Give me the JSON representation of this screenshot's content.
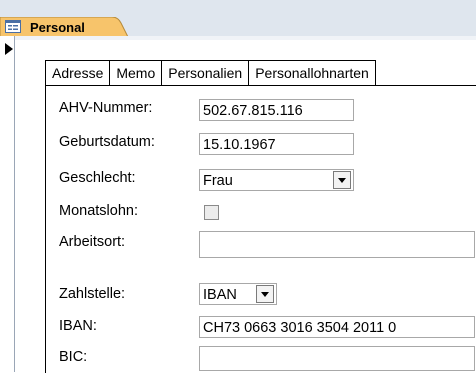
{
  "document_tab": {
    "title": "Personal",
    "icon": "form-icon"
  },
  "record_selector": {
    "icon": "current-record-arrow-icon"
  },
  "tabs": [
    "Adresse",
    "Memo",
    "Personalien",
    "Personallohnarten"
  ],
  "active_tab": "Personalien",
  "fields": {
    "ahv_label": "AHV-Nummer:",
    "ahv_value": "502.67.815.116",
    "geburtsdatum_label": "Geburtsdatum:",
    "geburtsdatum_value": "15.10.1967",
    "geschlecht_label": "Geschlecht:",
    "geschlecht_value": "Frau",
    "monatslohn_label": "Monatslohn:",
    "monatslohn_checked": false,
    "arbeitsort_label": "Arbeitsort:",
    "arbeitsort_value": "",
    "zahlstelle_label": "Zahlstelle:",
    "zahlstelle_value": "IBAN",
    "iban_label": "IBAN:",
    "iban_value": "CH73 0663 3016 3504 2011 0",
    "bic_label": "BIC:",
    "bic_value": ""
  },
  "colors": {
    "tab_orange": "#f7c46b",
    "strip": "#dfe6ee"
  }
}
